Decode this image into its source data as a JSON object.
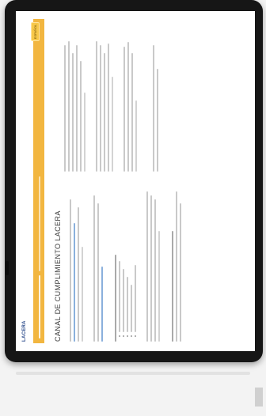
{
  "site": {
    "logo_text": "LACERA"
  },
  "banner": {
    "badge_text": "ESPAÑOL"
  },
  "main": {
    "title": "CANAL DE CUMPLIMIENTO LACERA"
  }
}
